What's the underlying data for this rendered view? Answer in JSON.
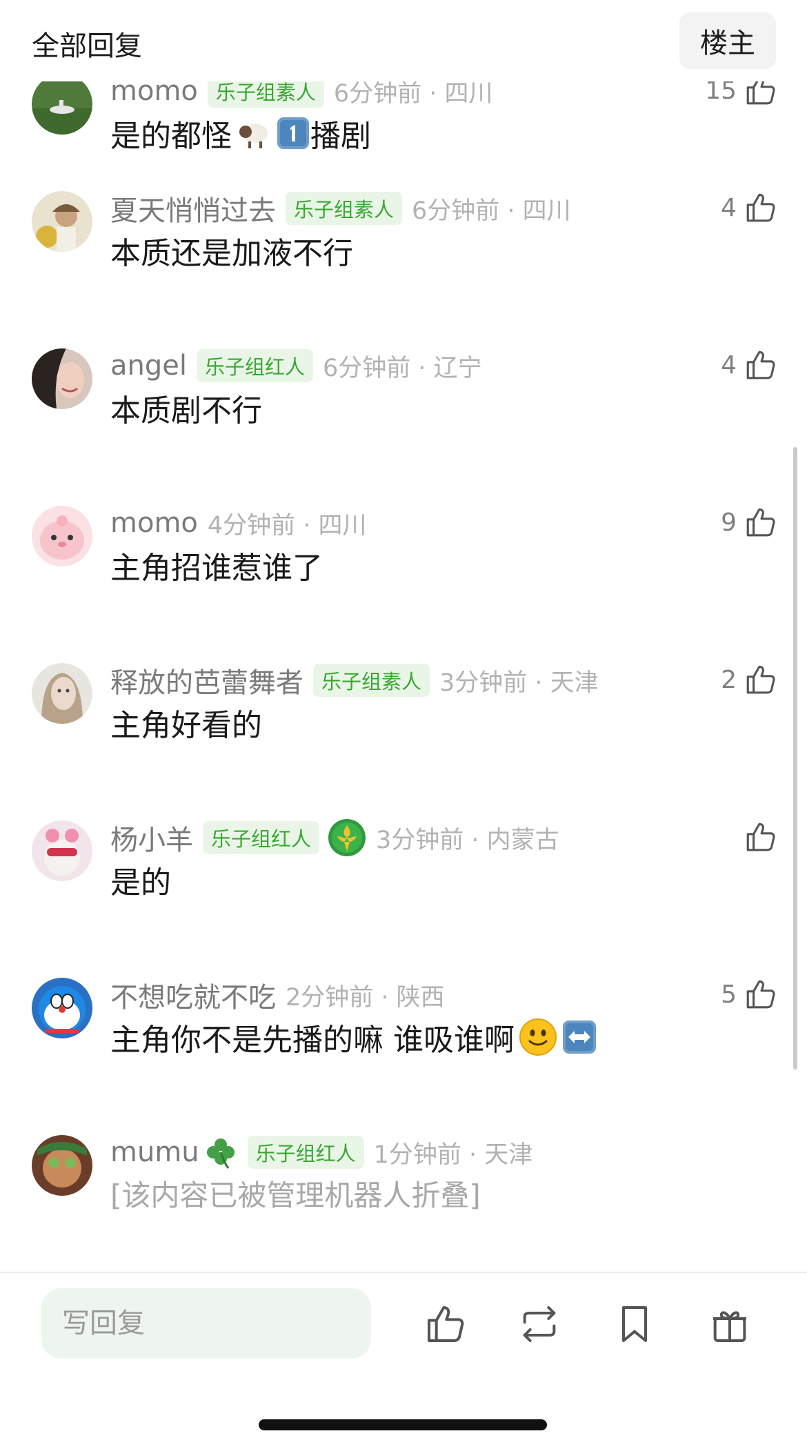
{
  "header": {
    "title": "全部回复",
    "op_button": "楼主"
  },
  "comments": [
    {
      "username": "momo",
      "badge": "乐子组素人",
      "time": "6分钟前 · 四川",
      "likes": "15",
      "text": "是的都怪",
      "text_suffix": "播剧",
      "emojis": [
        "sheep-emoji",
        "keycap-1-emoji"
      ]
    },
    {
      "username": "夏天悄悄过去",
      "badge": "乐子组素人",
      "time": "6分钟前 · 四川",
      "likes": "4",
      "text": "本质还是加液不行"
    },
    {
      "username": "angel",
      "badge": "乐子组红人",
      "time": "6分钟前 · 辽宁",
      "likes": "4",
      "text": "本质剧不行"
    },
    {
      "username": "momo",
      "badge": "",
      "time": "4分钟前 · 四川",
      "likes": "9",
      "text": "主角招谁惹谁了"
    },
    {
      "username": "释放的芭蕾舞者",
      "badge": "乐子组素人",
      "time": "3分钟前 · 天津",
      "likes": "2",
      "text": "主角好看的"
    },
    {
      "username": "杨小羊",
      "badge": "乐子组红人",
      "time": "3分钟前 · 内蒙古",
      "likes": "",
      "text": "是的",
      "icons": [
        "medal-icon"
      ]
    },
    {
      "username": "不想吃就不吃",
      "badge": "",
      "time": "2分钟前 · 陕西",
      "likes": "5",
      "text": "主角你不是先播的嘛 谁吸谁啊",
      "emojis": [
        "smile-emoji",
        "left-right-arrow-emoji"
      ]
    },
    {
      "username": "mumu",
      "badge": "乐子组红人",
      "time": "1分钟前 · 天津",
      "likes": "",
      "text": "[该内容已被管理机器人折叠]",
      "emojis": [
        "clover-emoji"
      ]
    }
  ],
  "reply_bar": {
    "placeholder": "写回复",
    "icons": [
      "thumbs-up-icon",
      "repost-icon",
      "bookmark-icon",
      "gift-icon"
    ]
  },
  "colors": {
    "badge_bg": "#e9f6e7",
    "badge_text": "#3aa733",
    "input_bg": "#eef5ee",
    "meta_text": "#b2b2b2"
  }
}
